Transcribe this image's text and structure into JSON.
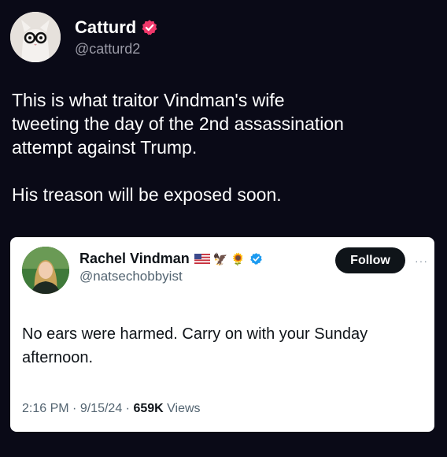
{
  "post": {
    "author": {
      "name": "Catturd",
      "handle": "@catturd2",
      "verified_color": "#f0386b"
    },
    "text_lines": [
      "This is what traitor Vindman's wife",
      "tweeting the day of the 2nd assassination",
      "attempt against Trump."
    ],
    "text_line_2": "His treason will be exposed soon."
  },
  "quoted": {
    "author": {
      "name": "Rachel Vindman",
      "handle": "@natsechobbyist",
      "emoji_eagle": "🦅",
      "emoji_sunflower": "🌻",
      "verified_color": "#1d9bf0"
    },
    "follow_label": "Follow",
    "more_label": "···",
    "text": "No ears were harmed. Carry on with your Sunday afternoon.",
    "time": "2:16 PM",
    "date": "9/15/24",
    "separator": "·",
    "views_count": "659K",
    "views_label": "Views"
  },
  "colors": {
    "background": "#0a0a17",
    "card": "#ffffff",
    "accent_blue": "#1d9bf0"
  }
}
